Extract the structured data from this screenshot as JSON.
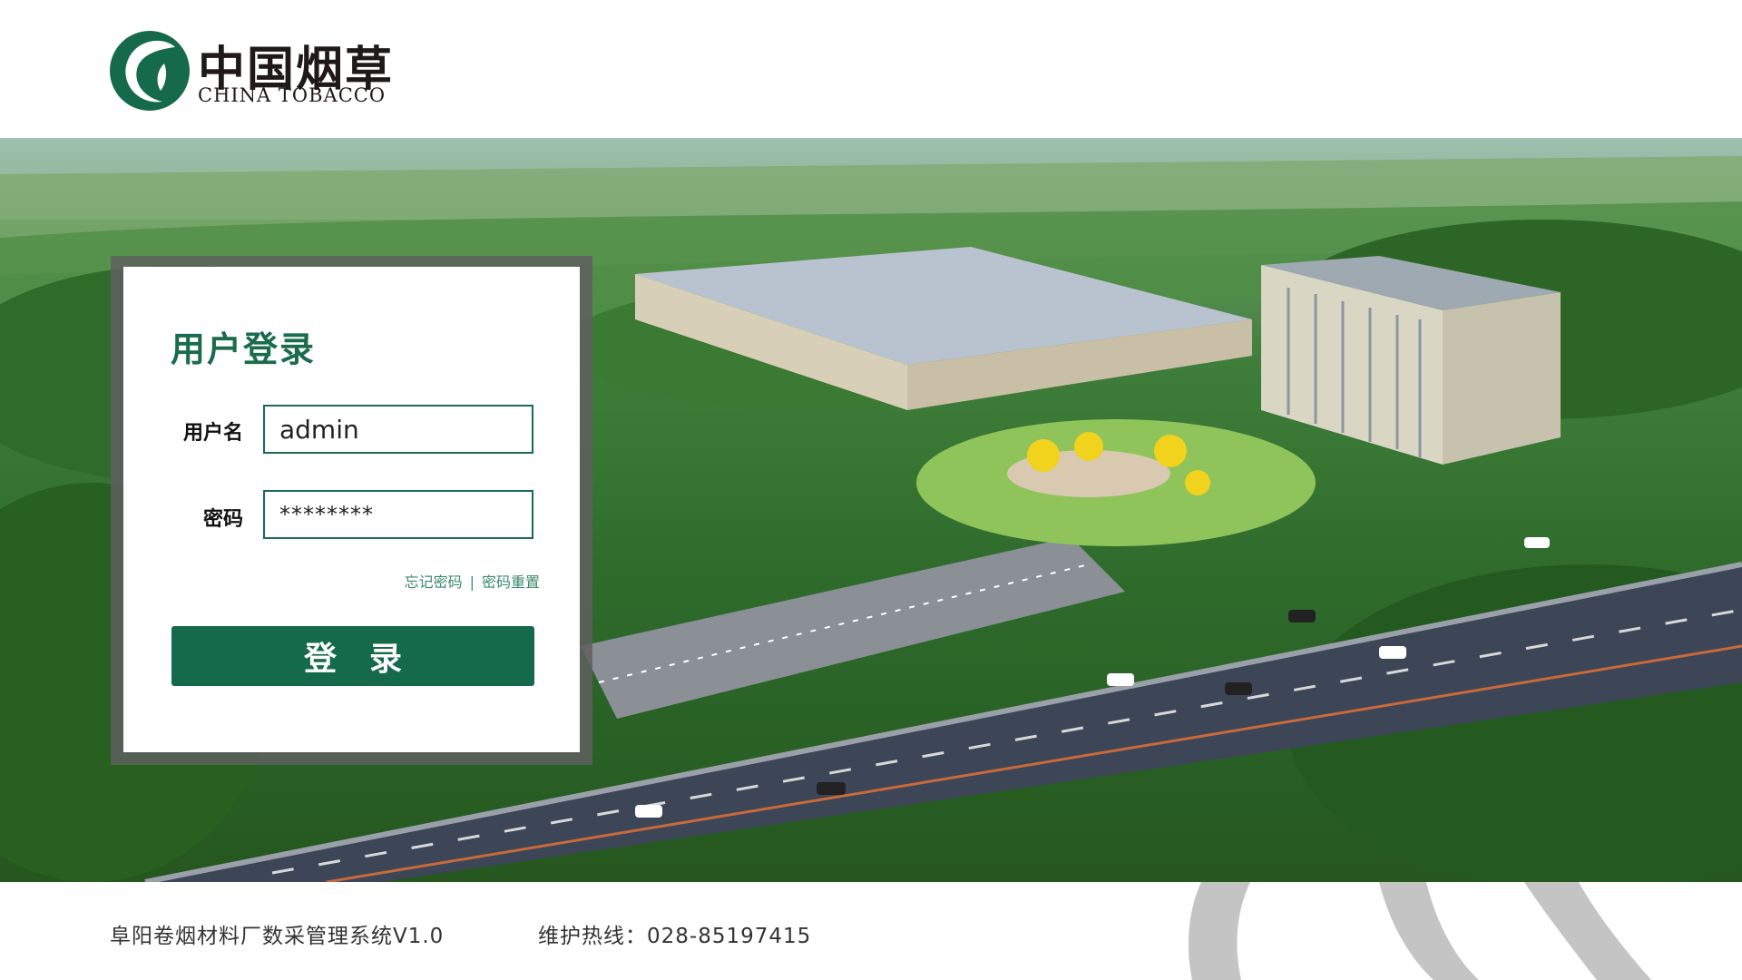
{
  "brand": {
    "name_cn": "中国烟草",
    "name_en": "CHINA TOBACCO",
    "logo_icon": "china-tobacco-leaf-logo",
    "color": "#1b6b4d"
  },
  "login": {
    "title": "用户登录",
    "username_label": "用户名",
    "username_value": "admin",
    "password_label": "密码",
    "password_value": "********",
    "forgot_link": "忘记密码",
    "separator": "|",
    "reset_link": "密码重置",
    "submit_label": "登录"
  },
  "footer": {
    "system_name": "阜阳卷烟材料厂数采管理系统V1.0",
    "hotline": "维护热线：028-85197415"
  },
  "colors": {
    "accent": "#156a4b",
    "link": "#3b8a6c",
    "text": "#333333"
  }
}
